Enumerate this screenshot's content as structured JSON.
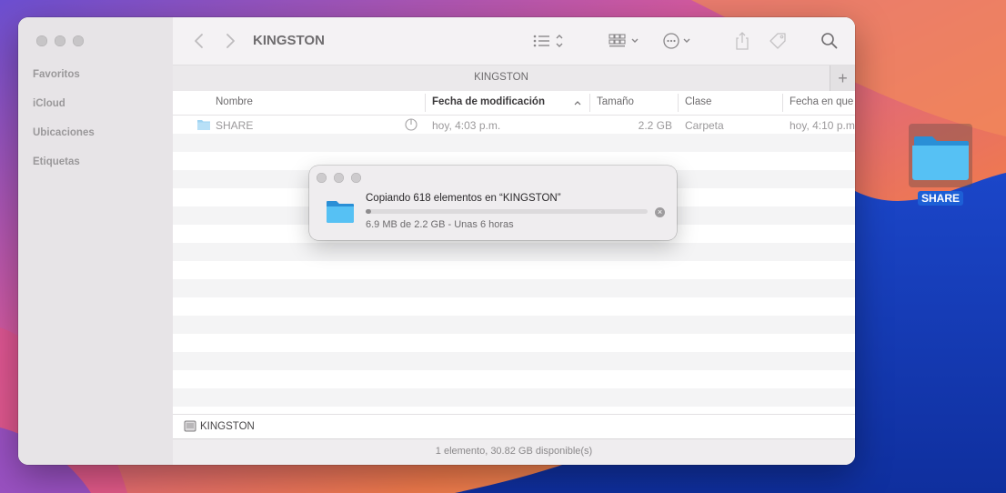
{
  "window": {
    "title": "KINGSTON",
    "tab_title": "KINGSTON",
    "tab_add": "+"
  },
  "sidebar": {
    "sections": [
      {
        "label": "Favoritos"
      },
      {
        "label": "iCloud"
      },
      {
        "label": "Ubicaciones"
      },
      {
        "label": "Etiquetas"
      }
    ]
  },
  "toolbar": {
    "icons": [
      "back-arrow-icon",
      "forward-arrow-icon",
      "list-view-icon",
      "grid-group-icon",
      "more-actions-icon",
      "share-icon",
      "tag-icon",
      "search-icon"
    ]
  },
  "columns": {
    "name": "Nombre",
    "modified": "Fecha de modificación",
    "size": "Tamaño",
    "kind": "Clase",
    "date_added": "Fecha en que"
  },
  "files": [
    {
      "name": "SHARE",
      "modified": "hoy, 4:03 p.m.",
      "size": "2.2 GB",
      "kind": "Carpeta",
      "date_added": "hoy, 4:10 p.m."
    }
  ],
  "pathbar": {
    "label": "KINGSTON"
  },
  "status": {
    "text": "1 elemento, 30.82 GB disponible(s)"
  },
  "copy_dialog": {
    "title": "Copiando 618 elementos en “KINGSTON”",
    "subtitle": "6.9 MB de 2.2 GB - Unas 6 horas",
    "progress_fraction": 0.02,
    "cancel_symbol": "×"
  },
  "desktop": {
    "icon_label": "SHARE"
  },
  "colors": {
    "folder_blue": "#4fb7ef",
    "selection_blue": "#1d5fd6"
  }
}
